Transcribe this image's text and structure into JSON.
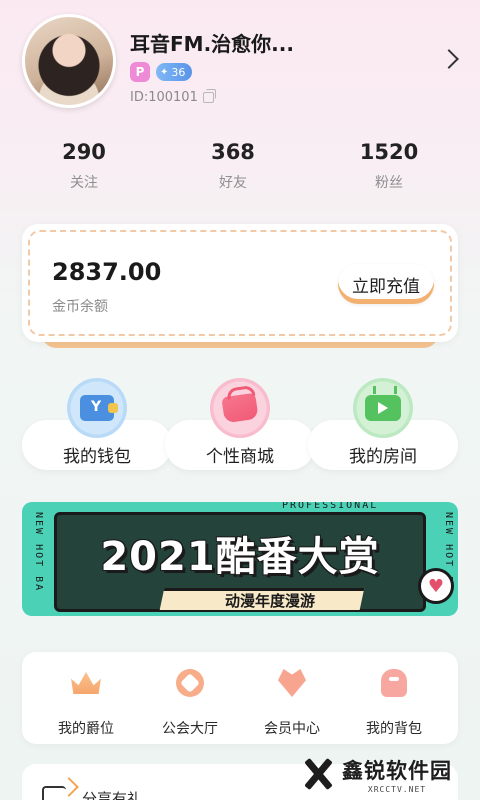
{
  "profile": {
    "username": "耳音FM.治愈你...",
    "badge_p": "P",
    "level": "36",
    "user_id": "ID:100101"
  },
  "stats": [
    {
      "value": "290",
      "label": "关注"
    },
    {
      "value": "368",
      "label": "好友"
    },
    {
      "value": "1520",
      "label": "粉丝"
    }
  ],
  "wallet": {
    "amount": "2837.00",
    "label": "金币余额",
    "recharge_label": "立即充值"
  },
  "quick_actions": [
    {
      "label": "我的钱包",
      "icon": "wallet-icon"
    },
    {
      "label": "个性商城",
      "icon": "shop-icon"
    },
    {
      "label": "我的房间",
      "icon": "room-tv-icon"
    }
  ],
  "banner": {
    "title": "2021酷番大赏",
    "subtitle": "动漫年度漫游",
    "top_text": "PROFESSIONAL",
    "side_left": "NEW HOT BA",
    "side_right": "NEW HOT BA",
    "bg_color": "#4ad1b6"
  },
  "menu": [
    {
      "label": "我的爵位",
      "icon": "crown-icon"
    },
    {
      "label": "公会大厅",
      "icon": "guild-hall-icon"
    },
    {
      "label": "会员中心",
      "icon": "vip-heart-icon"
    },
    {
      "label": "我的背包",
      "icon": "backpack-icon"
    }
  ],
  "share": {
    "label": "分享有礼"
  },
  "watermark": {
    "main": "鑫锐软件园",
    "sub": "XRCCTV.NET"
  },
  "colors": {
    "accent_orange": "#f2b170",
    "badge_pink": "#ef8ad7",
    "level_blue": "#5a93e8"
  }
}
